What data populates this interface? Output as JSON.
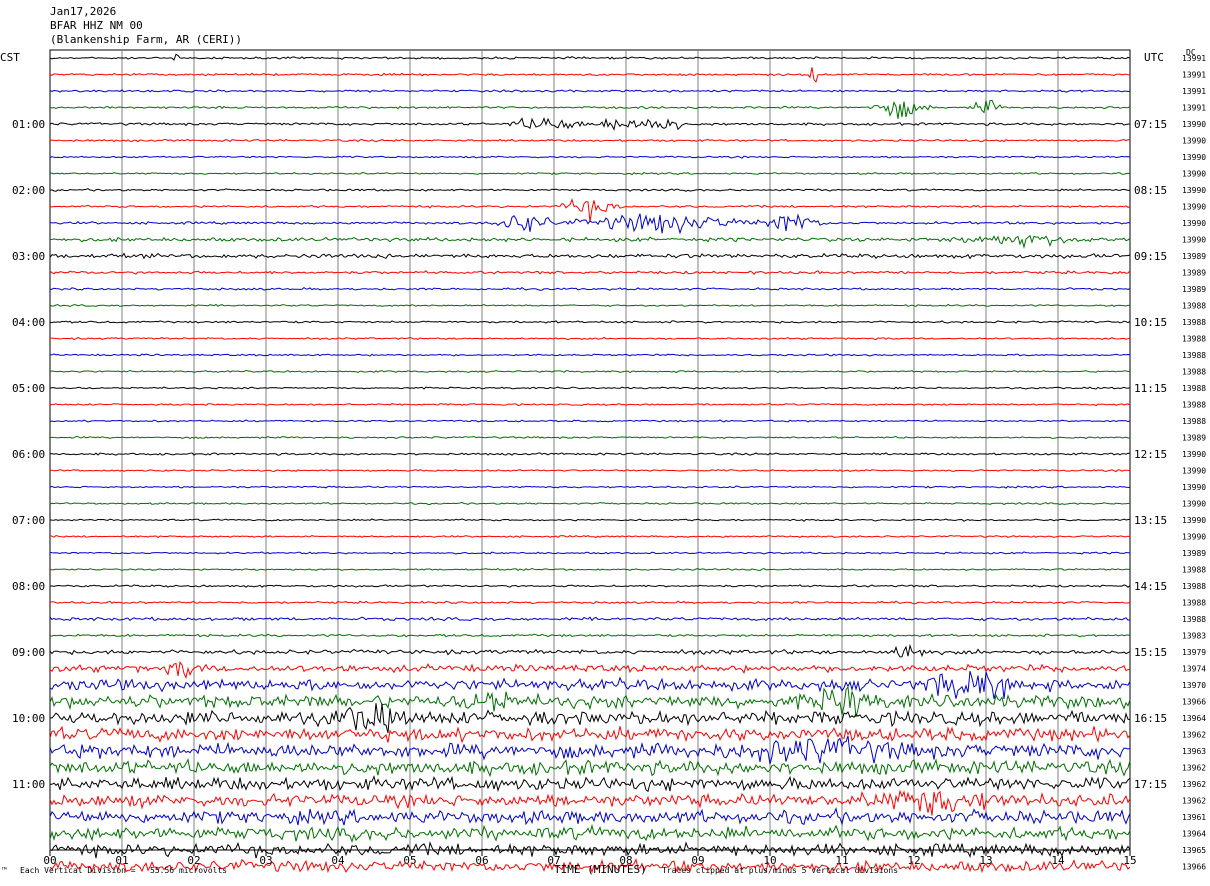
{
  "header": {
    "date": "Jan17,2026",
    "station": "BFAR HHZ NM 00",
    "location": "(Blankenship Farm, AR (CERI))"
  },
  "left_axis_label": "CST",
  "right_axis_label": "UTC",
  "dc_label": "DC",
  "footer": {
    "scale": "Each Vertical Division =   55.56 microvolts",
    "xlabel": "TIME (MINUTES)",
    "clip_note": "Traces clipped at plus/minus 5 vertical divisions"
  },
  "colors": {
    "cycle": [
      "#000000",
      "#ff0000",
      "#0000cc",
      "#007000"
    ],
    "grid": "#808080"
  },
  "chart_data": {
    "type": "line",
    "title": "",
    "xlabel": "TIME (MINUTES)",
    "xlim": [
      0,
      15
    ],
    "x_ticks": [
      "00",
      "01",
      "02",
      "03",
      "04",
      "05",
      "06",
      "07",
      "08",
      "09",
      "10",
      "11",
      "12",
      "13",
      "14",
      "15"
    ],
    "left_time_labels": [
      "01:00",
      "02:00",
      "03:00",
      "04:00",
      "05:00",
      "06:00",
      "07:00",
      "08:00",
      "09:00",
      "10:00",
      "11:00"
    ],
    "right_time_labels": [
      "07:15",
      "08:15",
      "09:15",
      "10:15",
      "11:15",
      "12:15",
      "13:15",
      "14:15",
      "15:15",
      "16:15",
      "17:15"
    ],
    "dc_offsets": [
      "13991",
      "13991",
      "13991",
      "13991",
      "13990",
      "13990",
      "13990",
      "13990",
      "13990",
      "13990",
      "13990",
      "13990",
      "13989",
      "13989",
      "13989",
      "13988",
      "13988",
      "13988",
      "13988",
      "13988",
      "13988",
      "13988",
      "13988",
      "13989",
      "13990",
      "13990",
      "13990",
      "13990",
      "13990",
      "13990",
      "13989",
      "13988",
      "13988",
      "13988",
      "13988",
      "13983",
      "13979",
      "13974",
      "13970",
      "13966",
      "13964",
      "13962",
      "13963",
      "13962",
      "13962",
      "13962",
      "13961",
      "13964",
      "13965",
      "13966"
    ],
    "trace_noise": [
      0.6,
      0.6,
      0.6,
      0.6,
      0.7,
      0.6,
      0.5,
      0.5,
      0.6,
      0.6,
      0.7,
      1.1,
      1.2,
      0.8,
      0.6,
      0.5,
      0.6,
      0.5,
      0.5,
      0.5,
      0.5,
      0.5,
      0.5,
      0.5,
      0.6,
      0.5,
      0.5,
      0.5,
      0.5,
      0.5,
      0.5,
      0.5,
      0.6,
      0.6,
      0.9,
      0.7,
      1.2,
      2.0,
      3.2,
      3.8,
      4.0,
      3.8,
      4.2,
      4.0,
      3.8,
      3.6,
      3.8,
      3.8,
      3.5,
      3.2
    ],
    "events": [
      {
        "trace": 0,
        "minute": 1.75,
        "amp": 5,
        "dur": 0.05
      },
      {
        "trace": 1,
        "minute": 10.6,
        "amp": 30,
        "dur": 0.05
      },
      {
        "trace": 3,
        "minute": 11.8,
        "amp": 6,
        "dur": 0.5
      },
      {
        "trace": 3,
        "minute": 13.0,
        "amp": 5,
        "dur": 0.25
      },
      {
        "trace": 4,
        "minute": 6.9,
        "amp": 5,
        "dur": 0.6
      },
      {
        "trace": 4,
        "minute": 7.9,
        "amp": 6,
        "dur": 0.4
      },
      {
        "trace": 4,
        "minute": 8.5,
        "amp": 9,
        "dur": 0.3
      },
      {
        "trace": 9,
        "minute": 7.5,
        "amp": 6,
        "dur": 0.5
      },
      {
        "trace": 10,
        "minute": 6.6,
        "amp": 7,
        "dur": 0.5
      },
      {
        "trace": 10,
        "minute": 8.5,
        "amp": 6,
        "dur": 1.5
      },
      {
        "trace": 10,
        "minute": 10.3,
        "amp": 7,
        "dur": 0.5
      },
      {
        "trace": 11,
        "minute": 13.5,
        "amp": 3,
        "dur": 1.2
      },
      {
        "trace": 36,
        "minute": 11.9,
        "amp": 6,
        "dur": 0.3
      },
      {
        "trace": 37,
        "minute": 1.9,
        "amp": 5,
        "dur": 0.3
      },
      {
        "trace": 38,
        "minute": 12.8,
        "amp": 8,
        "dur": 0.8
      },
      {
        "trace": 39,
        "minute": 6.1,
        "amp": 7,
        "dur": 0.4
      },
      {
        "trace": 39,
        "minute": 11.0,
        "amp": 8,
        "dur": 0.5
      },
      {
        "trace": 40,
        "minute": 4.4,
        "amp": 6,
        "dur": 0.6
      },
      {
        "trace": 42,
        "minute": 10.7,
        "amp": 5,
        "dur": 1.5
      },
      {
        "trace": 45,
        "minute": 12.3,
        "amp": 6,
        "dur": 1.2
      }
    ]
  }
}
